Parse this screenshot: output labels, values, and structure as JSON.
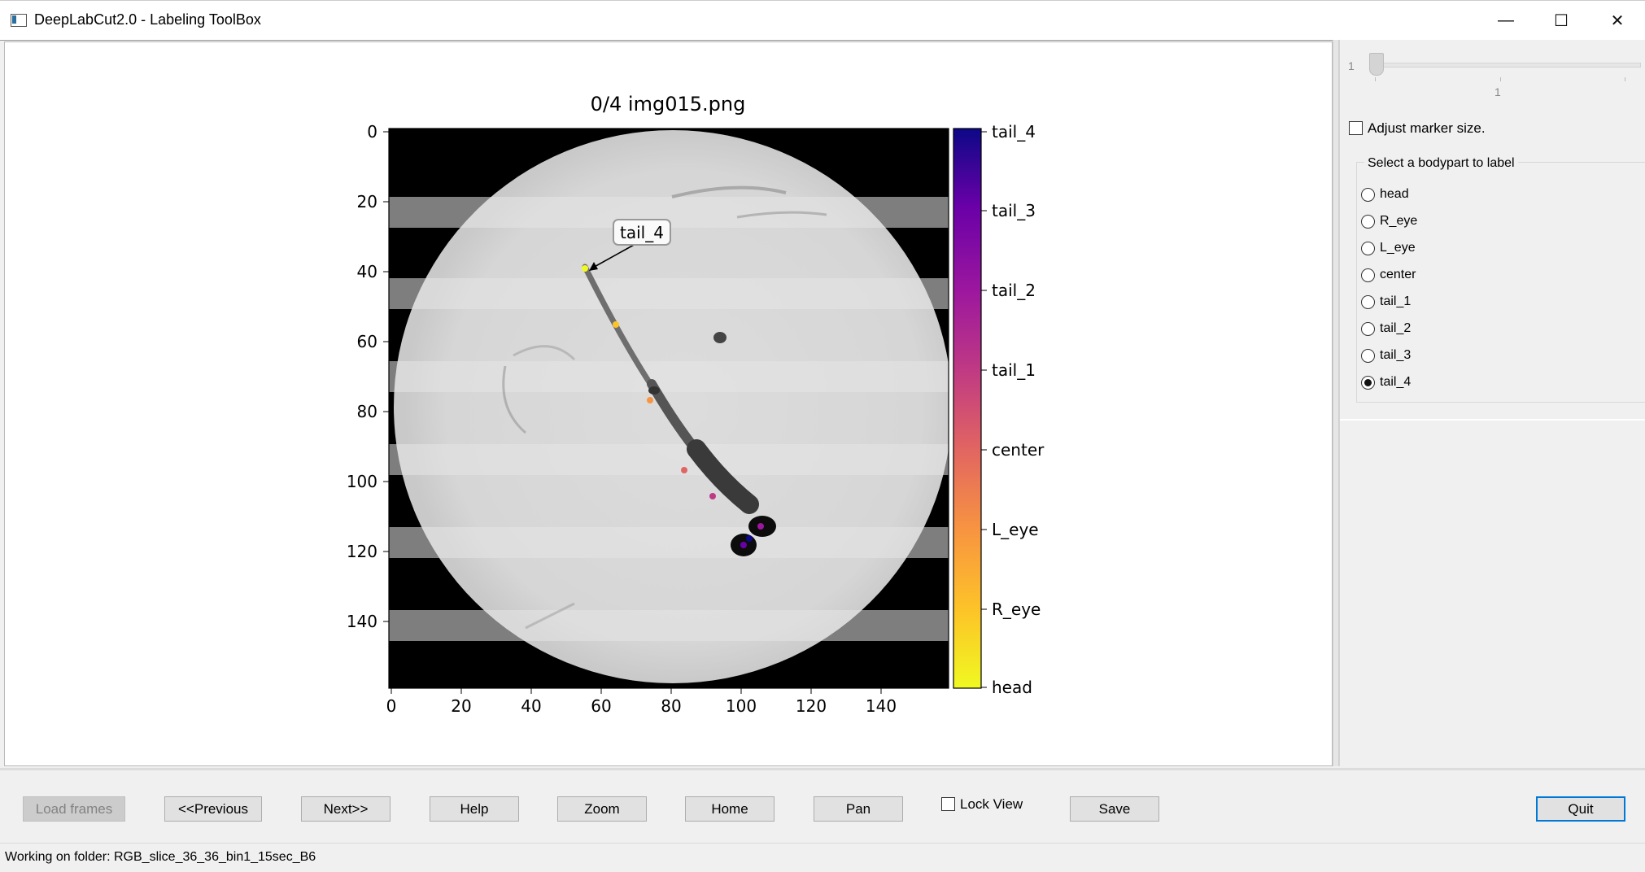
{
  "window": {
    "title": "DeepLabCut2.0 - Labeling ToolBox",
    "controls": {
      "minimize": "—",
      "maximize": "☐",
      "close": "✕"
    }
  },
  "plot": {
    "title": "0/4 img015.png",
    "x_ticks": [
      "0",
      "20",
      "40",
      "60",
      "80",
      "100",
      "120",
      "140"
    ],
    "y_ticks": [
      "0",
      "20",
      "40",
      "60",
      "80",
      "100",
      "120",
      "140"
    ],
    "annotation": "tail_4",
    "colorbar_labels": [
      "tail_4",
      "tail_3",
      "tail_2",
      "tail_1",
      "center",
      "L_eye",
      "R_eye",
      "head"
    ],
    "colormap": "plasma"
  },
  "right_panel": {
    "slider": {
      "min_label": "1",
      "value_label": "1"
    },
    "adjust_marker_label": "Adjust marker size.",
    "adjust_marker_checked": false,
    "bodypart_group_title": "Select a bodypart to label",
    "bodyparts": [
      "head",
      "R_eye",
      "L_eye",
      "center",
      "tail_1",
      "tail_2",
      "tail_3",
      "tail_4"
    ],
    "selected_bodypart": "tail_4"
  },
  "toolbar": {
    "load_frames": "Load frames",
    "previous": "<<Previous",
    "next": "Next>>",
    "help": "Help",
    "zoom": "Zoom",
    "home": "Home",
    "pan": "Pan",
    "lock_view": "Lock View",
    "lock_view_checked": false,
    "save": "Save",
    "quit": "Quit"
  },
  "status": {
    "text": "Working on folder: RGB_slice_36_36_bin1_15sec_B6"
  },
  "colors": {
    "accent": "#0078d7",
    "annotation_border": "#999999"
  }
}
